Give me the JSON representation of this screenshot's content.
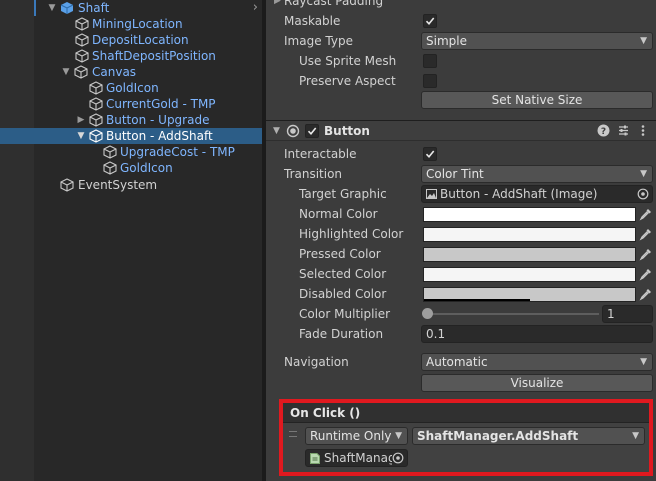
{
  "hierarchy": {
    "items": [
      {
        "label": "Shaft",
        "kind": "prefab",
        "expanded": true,
        "selected": false
      },
      {
        "label": "MiningLocation",
        "kind": "prefab",
        "selected": false
      },
      {
        "label": "DepositLocation",
        "kind": "prefab",
        "selected": false
      },
      {
        "label": "ShaftDepositPosition",
        "kind": "prefab",
        "selected": false
      },
      {
        "label": "Canvas",
        "kind": "prefab",
        "expanded": true,
        "selected": false
      },
      {
        "label": "GoldIcon",
        "kind": "prefab",
        "selected": false
      },
      {
        "label": "CurrentGold - TMP",
        "kind": "prefab",
        "selected": false
      },
      {
        "label": "Button - Upgrade",
        "kind": "prefab",
        "expanded": false,
        "selected": false
      },
      {
        "label": "Button - AddShaft",
        "kind": "prefab",
        "expanded": true,
        "selected": true
      },
      {
        "label": "UpgradeCost - TMP",
        "kind": "prefab",
        "selected": false
      },
      {
        "label": "GoldIcon",
        "kind": "prefab",
        "selected": false
      },
      {
        "label": "EventSystem",
        "kind": "plain",
        "selected": false
      }
    ]
  },
  "image_component": {
    "partial_header": "Raycast Padding",
    "maskable": {
      "label": "Maskable",
      "checked": true
    },
    "image_type": {
      "label": "Image Type",
      "value": "Simple"
    },
    "use_sprite_mesh": {
      "label": "Use Sprite Mesh",
      "checked": false
    },
    "preserve_aspect": {
      "label": "Preserve Aspect",
      "checked": false
    },
    "set_native_size": "Set Native Size"
  },
  "button_component": {
    "title": "Button",
    "enabled": true,
    "interactable": {
      "label": "Interactable",
      "checked": true
    },
    "transition": {
      "label": "Transition",
      "value": "Color Tint"
    },
    "target_graphic": {
      "label": "Target Graphic",
      "value": "Button - AddShaft (Image)"
    },
    "normal_color": {
      "label": "Normal Color",
      "color": "#ffffff"
    },
    "highlighted_color": {
      "label": "Highlighted Color",
      "color": "#f5f5f5"
    },
    "pressed_color": {
      "label": "Pressed Color",
      "color": "#c8c8c8"
    },
    "selected_color": {
      "label": "Selected Color",
      "color": "#f5f5f5"
    },
    "disabled_color": {
      "label": "Disabled Color",
      "color": "#c8c8c8"
    },
    "color_multiplier": {
      "label": "Color Multiplier",
      "value": "1",
      "slider_fraction": 0.0
    },
    "fade_duration": {
      "label": "Fade Duration",
      "value": "0.1"
    },
    "navigation": {
      "label": "Navigation",
      "value": "Automatic"
    },
    "visualize": "Visualize"
  },
  "on_click": {
    "header": "On Click ()",
    "runtime": "Runtime Only",
    "function": "ShaftManager.AddShaft",
    "object": "ShaftManag"
  },
  "colors": {
    "highlight_box": "#e0191f",
    "selection": "#2c5d87",
    "prefab_text": "#7fb6ff"
  }
}
